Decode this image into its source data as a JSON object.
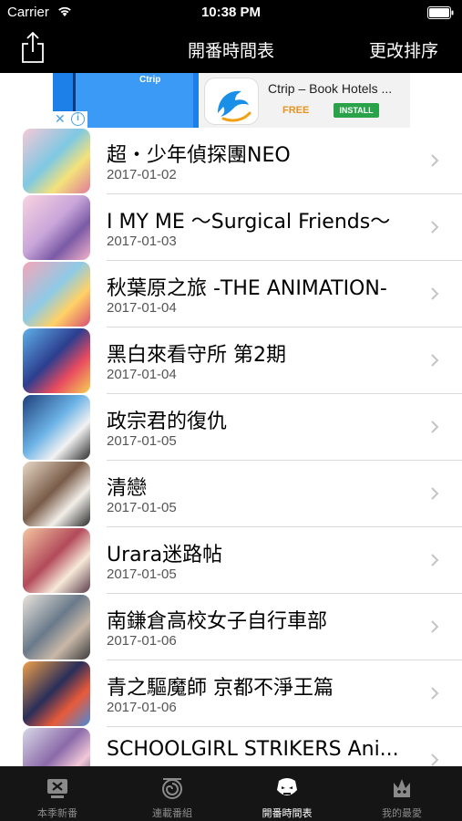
{
  "status": {
    "carrier": "Carrier",
    "time": "10:38 PM"
  },
  "nav": {
    "title": "開番時間表",
    "right_label": "更改排序",
    "share_icon": "share-icon"
  },
  "ad": {
    "title": "Ctrip – Book Hotels ...",
    "price": "FREE",
    "install_label": "INSTALL",
    "mini_brand": "Ctrip",
    "close_label": "✕",
    "info_label": "i"
  },
  "colors": {
    "bar_bg": "#000000",
    "tab_bg": "#151515",
    "install_green": "#2aa24a",
    "free_orange": "#e89421"
  },
  "list": {
    "items": [
      {
        "title": "超・少年偵探團NEO",
        "date": "2017-01-02"
      },
      {
        "title": "I MY ME ～Surgical Friends～",
        "date": "2017-01-03"
      },
      {
        "title": "秋葉原之旅 -THE ANIMATION-",
        "date": "2017-01-04"
      },
      {
        "title": "黑白來看守所 第2期",
        "date": "2017-01-04"
      },
      {
        "title": "政宗君的復仇",
        "date": "2017-01-05"
      },
      {
        "title": "清戀",
        "date": "2017-01-05"
      },
      {
        "title": "Urara迷路帖",
        "date": "2017-01-05"
      },
      {
        "title": "南鎌倉高校女子自行車部",
        "date": "2017-01-06"
      },
      {
        "title": "青之驅魔師 京都不淨王篇",
        "date": "2017-01-06"
      },
      {
        "title": "SCHOOLGIRL STRIKERS Ani...",
        "date": ""
      }
    ]
  },
  "tabs": [
    {
      "label": "本季新番",
      "icon": "tv-icon",
      "active": false
    },
    {
      "label": "連載番組",
      "icon": "swirl-icon",
      "active": false
    },
    {
      "label": "開番時間表",
      "icon": "mask-icon",
      "active": true
    },
    {
      "label": "我的最愛",
      "icon": "crown-icon",
      "active": false
    }
  ]
}
